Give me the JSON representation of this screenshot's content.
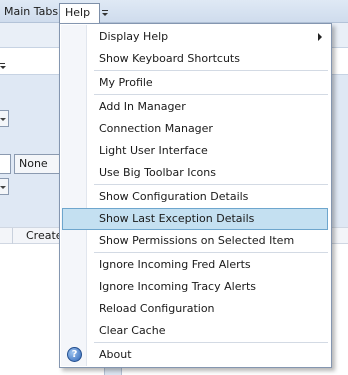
{
  "menubar": {
    "main_tabs_label": "Main Tabs",
    "help_label": "Help"
  },
  "background": {
    "select_value": "None",
    "column_header": "Create"
  },
  "menu": {
    "groups": [
      [
        "Display Help",
        "Show Keyboard Shortcuts"
      ],
      [
        "My Profile"
      ],
      [
        "Add In Manager",
        "Connection Manager",
        "Light User Interface",
        "Use Big Toolbar Icons"
      ],
      [
        "Show Configuration Details",
        "Show Last Exception Details",
        "Show Permissions on Selected Item"
      ],
      [
        "Ignore Incoming Fred Alerts",
        "Ignore Incoming Tracy Alerts",
        "Reload Configuration",
        "Clear Cache"
      ],
      [
        "About"
      ]
    ],
    "highlighted_item": "Show Last Exception Details",
    "submenu_item": "Display Help",
    "about_icon_glyph": "?"
  },
  "colors": {
    "highlight_bg": "#c4e0f1",
    "highlight_border": "#6ea6cd",
    "menubar_bg": "#cfdced"
  }
}
